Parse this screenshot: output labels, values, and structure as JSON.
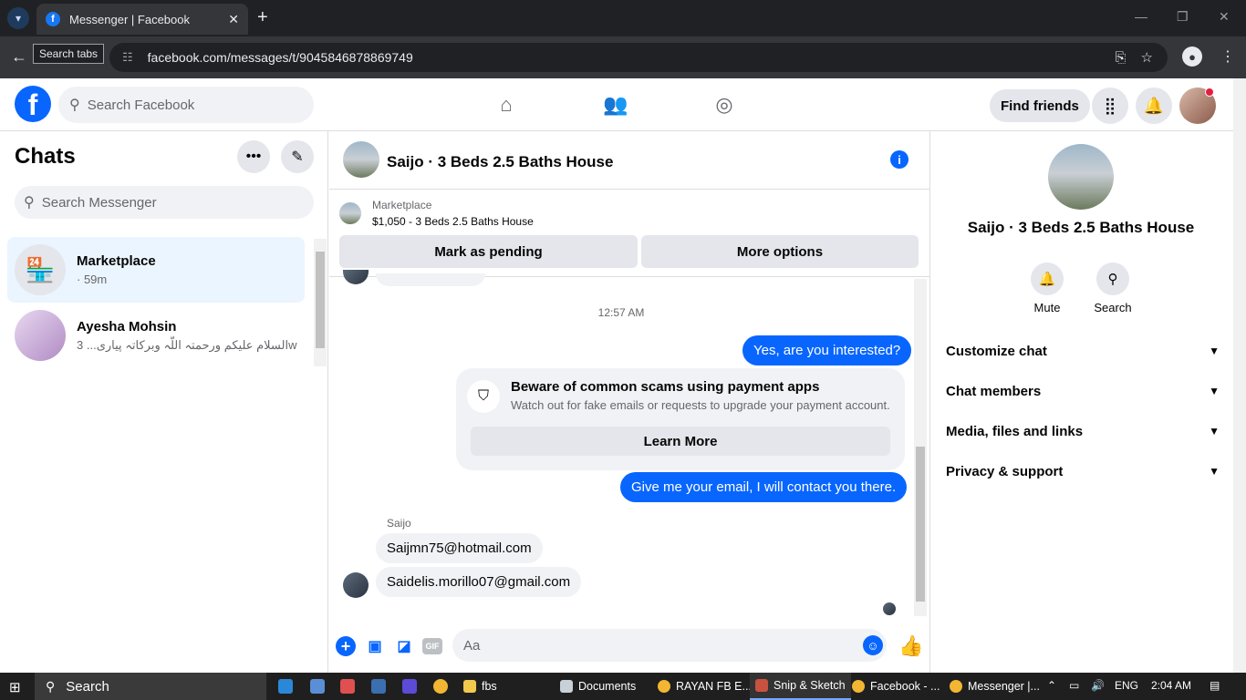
{
  "browser": {
    "tab_title": "Messenger | Facebook",
    "tooltip": "Search tabs",
    "url": "facebook.com/messages/t/9045846878869749"
  },
  "fbnav": {
    "search_placeholder": "Search Facebook",
    "find_friends": "Find friends"
  },
  "left": {
    "title": "Chats",
    "search_placeholder": "Search Messenger",
    "chats": [
      {
        "name": "Marketplace",
        "preview": "· 59m"
      },
      {
        "name": "Ayesha Mohsin",
        "preview": "السلام عليكم ورحمتہ اللّہ وبرکاتہ پیاری...",
        "time": "3w"
      }
    ]
  },
  "conversation": {
    "title": "Saijo · 3 Beds 2.5 Baths House",
    "marketplace_label": "Marketplace",
    "listing": "$1,050 - 3 Beds 2.5 Baths House",
    "mark_pending": "Mark as pending",
    "more_options": "More options",
    "timestamp": "12:57 AM",
    "msg_out_1": "Yes, are you interested?",
    "scam_title": "Beware of common scams using payment apps",
    "scam_sub": "Watch out for fake emails or requests to upgrade your payment account.",
    "learn_more": "Learn More",
    "msg_out_2": "Give me your email, I will contact you there.",
    "sender_name": "Saijo",
    "msg_in_1": "Saijmn75@hotmail.com",
    "msg_in_2": "Saidelis.morillo07@gmail.com",
    "composer_placeholder": "Aa",
    "gif_label": "GIF"
  },
  "right": {
    "name": "Saijo · 3 Beds 2.5 Baths House",
    "mute": "Mute",
    "search": "Search",
    "sections": [
      "Customize chat",
      "Chat members",
      "Media, files and links",
      "Privacy & support"
    ]
  },
  "taskbar": {
    "search": "Search",
    "apps": [
      "fbs",
      "Documents",
      "RAYAN FB E...",
      "Snip & Sketch",
      "Facebook - ...",
      "Messenger |..."
    ],
    "lang": "ENG",
    "time": "2:04 AM"
  },
  "colors": {
    "accent": "#0866ff",
    "bubble_in": "#f0f2f5",
    "active_chat": "#ebf5ff"
  }
}
